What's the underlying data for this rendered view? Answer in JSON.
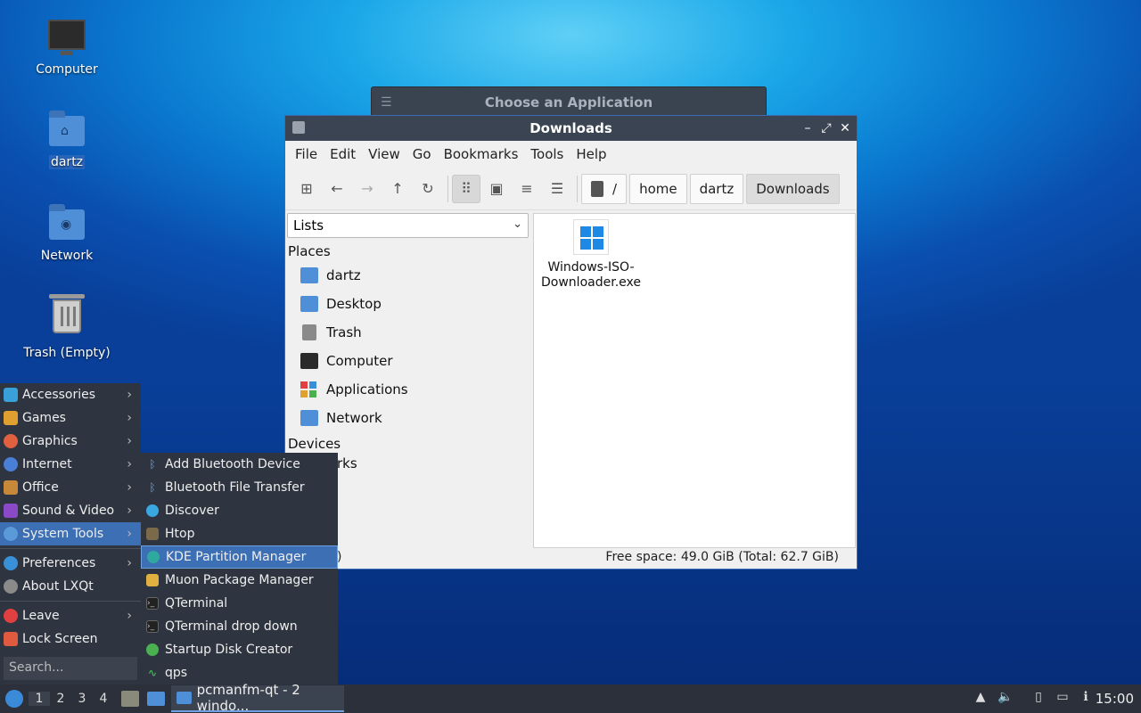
{
  "desktop": {
    "icons": [
      {
        "label": "Computer"
      },
      {
        "label": "dartz"
      },
      {
        "label": "Network"
      },
      {
        "label": "Trash (Empty)"
      }
    ]
  },
  "background_dialog": {
    "title": "Choose an Application"
  },
  "window": {
    "title": "Downloads",
    "menu": [
      "File",
      "Edit",
      "View",
      "Go",
      "Bookmarks",
      "Tools",
      "Help"
    ],
    "breadcrumb": [
      "/",
      "home",
      "dartz",
      "Downloads"
    ],
    "side_combo": "Lists",
    "places_header": "Places",
    "places": [
      "dartz",
      "Desktop",
      "Trash",
      "Computer",
      "Applications",
      "Network"
    ],
    "devices_header": "Devices",
    "bookmarks_partial": "rks",
    "status_partial": ")",
    "files": [
      {
        "name_line1": "Windows-ISO-",
        "name_line2": "Downloader.exe"
      }
    ],
    "free_space": "Free space: 49.0 GiB (Total: 62.7 GiB)"
  },
  "start_menu": {
    "items": [
      "Accessories",
      "Games",
      "Graphics",
      "Internet",
      "Office",
      "Sound & Video",
      "System Tools"
    ],
    "items2": [
      "Preferences",
      "About LXQt"
    ],
    "items3": [
      "Leave",
      "Lock Screen"
    ],
    "search_placeholder": "Search...",
    "icon_colors": {
      "accessories": "#3aa0d8",
      "games": "#e0a030",
      "graphics": "#e06040",
      "internet": "#4a7fd8",
      "office": "#c8883a",
      "sound": "#8a4ac8",
      "system": "#5a9ad8",
      "preferences": "#3a90d8",
      "about": "#8a8a8a",
      "leave": "#e04040",
      "lock": "#e05a40"
    }
  },
  "submenu": {
    "items": [
      "Add Bluetooth Device",
      "Bluetooth File Transfer",
      "Discover",
      "Htop",
      "KDE Partition Manager",
      "Muon Package Manager",
      "QTerminal",
      "QTerminal drop down",
      "Startup Disk Creator",
      "qps"
    ]
  },
  "taskbar": {
    "workspaces": [
      "1",
      "2",
      "3",
      "4"
    ],
    "task_label": "pcmanfm-qt - 2 windo...",
    "clock": "15:00"
  }
}
